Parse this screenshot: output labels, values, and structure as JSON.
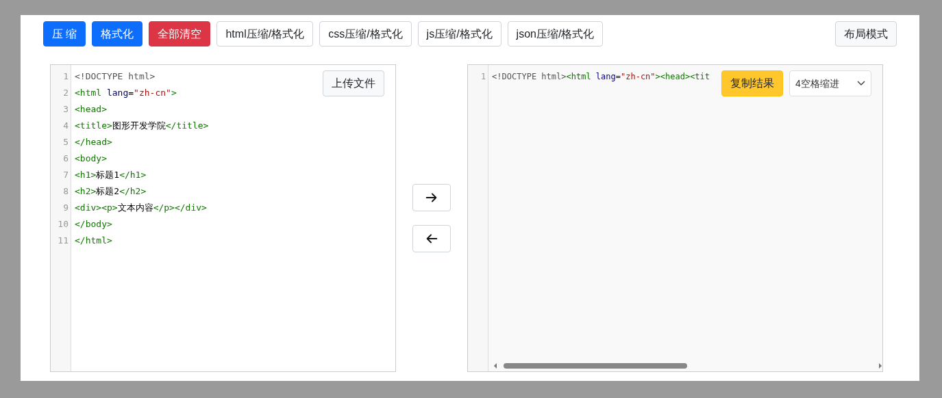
{
  "toolbar": {
    "buttons": [
      {
        "label": "压 缩",
        "kind": "primary"
      },
      {
        "label": "格式化",
        "kind": "primary"
      },
      {
        "label": "全部清空",
        "kind": "danger"
      },
      {
        "label": "html压缩/格式化",
        "kind": "outline"
      },
      {
        "label": "css压缩/格式化",
        "kind": "outline"
      },
      {
        "label": "js压缩/格式化",
        "kind": "outline"
      },
      {
        "label": "json压缩/格式化",
        "kind": "outline"
      }
    ],
    "layout_button": "布局模式"
  },
  "input_editor": {
    "upload_button": "上传文件",
    "lines": [
      {
        "number": "1",
        "tokens": [
          {
            "kind": "meta",
            "text": "<!DOCTYPE html>"
          }
        ]
      },
      {
        "number": "2",
        "tokens": [
          {
            "kind": "tag",
            "text": "<html "
          },
          {
            "kind": "attr",
            "text": "lang"
          },
          {
            "kind": "plain",
            "text": "="
          },
          {
            "kind": "string",
            "text": "\"zh-cn\""
          },
          {
            "kind": "tag",
            "text": ">"
          }
        ]
      },
      {
        "number": "3",
        "tokens": [
          {
            "kind": "tag",
            "text": "<head>"
          }
        ]
      },
      {
        "number": "4",
        "tokens": [
          {
            "kind": "tag",
            "text": "<title>"
          },
          {
            "kind": "plain",
            "text": "图形开发学院"
          },
          {
            "kind": "tag",
            "text": "</title>"
          }
        ]
      },
      {
        "number": "5",
        "tokens": [
          {
            "kind": "tag",
            "text": "</head>"
          }
        ]
      },
      {
        "number": "6",
        "tokens": [
          {
            "kind": "tag",
            "text": "<body>"
          }
        ]
      },
      {
        "number": "7",
        "tokens": [
          {
            "kind": "tag",
            "text": "<h1>"
          },
          {
            "kind": "plain",
            "text": "标题1"
          },
          {
            "kind": "tag",
            "text": "</h1>"
          }
        ]
      },
      {
        "number": "8",
        "tokens": [
          {
            "kind": "tag",
            "text": "<h2>"
          },
          {
            "kind": "plain",
            "text": "标题2"
          },
          {
            "kind": "tag",
            "text": "</h2>"
          }
        ]
      },
      {
        "number": "9",
        "tokens": [
          {
            "kind": "tag",
            "text": "<div><p>"
          },
          {
            "kind": "plain",
            "text": "文本内容"
          },
          {
            "kind": "tag",
            "text": "</p></div>"
          }
        ]
      },
      {
        "number": "10",
        "tokens": [
          {
            "kind": "tag",
            "text": "</body>"
          }
        ]
      },
      {
        "number": "11",
        "tokens": [
          {
            "kind": "tag",
            "text": "</html>"
          }
        ]
      }
    ]
  },
  "transfer_buttons": [
    {
      "kind": "arrow-right"
    },
    {
      "kind": "arrow-left"
    }
  ],
  "output_editor": {
    "copy_button": "复制结果",
    "indent_select": {
      "value": "4空格缩进"
    },
    "lines": [
      {
        "number": "1",
        "tokens": [
          {
            "kind": "meta",
            "text": "<!DOCTYPE html>"
          },
          {
            "kind": "tag",
            "text": "<html "
          },
          {
            "kind": "attr",
            "text": "lang"
          },
          {
            "kind": "plain",
            "text": "="
          },
          {
            "kind": "string",
            "text": "\"zh-cn\""
          },
          {
            "kind": "tag",
            "text": "><head><tit"
          }
        ]
      }
    ]
  }
}
